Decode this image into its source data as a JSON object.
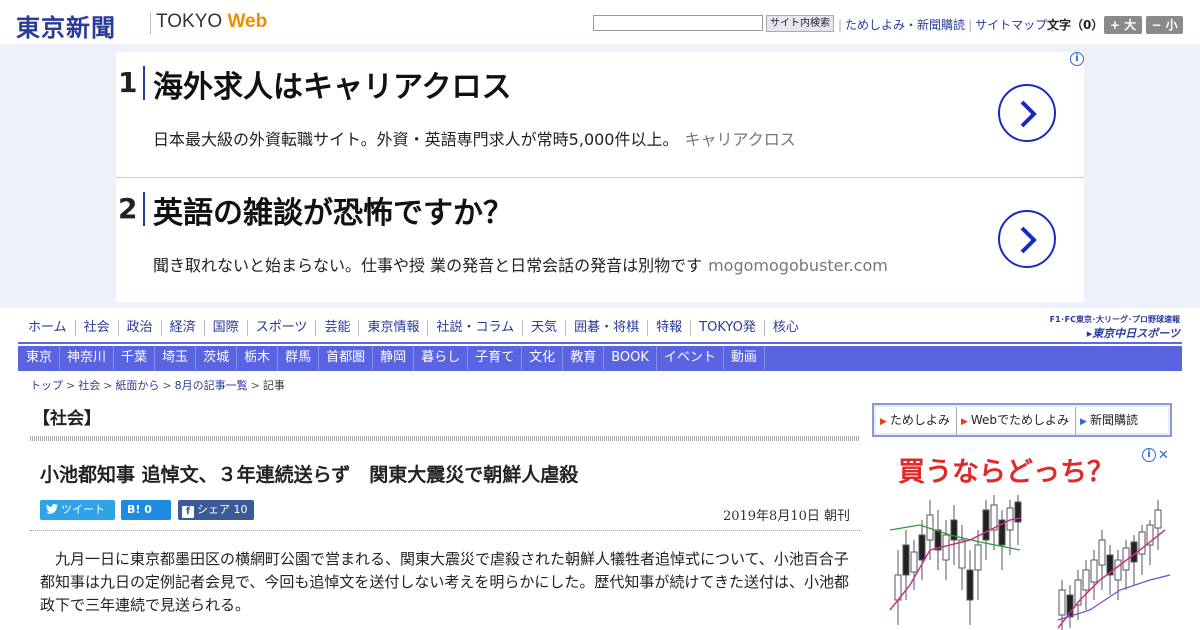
{
  "header": {
    "logo_jp": "東京新聞",
    "logo_en_prefix": "TOKYO ",
    "logo_en_web": "Web",
    "search_button": "サイト内検索",
    "links": [
      "ためしよみ・新聞購読",
      "サイトマップ"
    ],
    "fontsize_label": "文字（0）",
    "fontsize_plus": "+ 大",
    "fontsize_minus": "− 小"
  },
  "ads": {
    "info_icon": "info-icon",
    "items": [
      {
        "num": "1",
        "title": "海外求人はキャリアクロス",
        "desc": "日本最大級の外資転職サイト。外資・英語専門求人が常時5,000件以上。",
        "source": "キャリアクロス"
      },
      {
        "num": "2",
        "title": "英語の雑談が恐怖ですか？",
        "desc": "聞き取れないと始まらない。仕事や授 業の発音と日常会話の発音は別物です",
        "source": "mogomogobuster.com"
      }
    ]
  },
  "nav1": [
    "ホーム",
    "社会",
    "政治",
    "経済",
    "国際",
    "スポーツ",
    "芸能",
    "東京情報",
    "社説・コラム",
    "天気",
    "囲碁・将棋",
    "特報",
    "TOKYO発",
    "核心"
  ],
  "chunichi": {
    "top": "F1･FC東京･大リーグ･プロ野球速報",
    "logo": "▸東京中日スポーツ"
  },
  "nav2": [
    "東京",
    "神奈川",
    "千葉",
    "埼玉",
    "茨城",
    "栃木",
    "群馬",
    "首都圏",
    "静岡",
    "暮らし",
    "子育て",
    "文化",
    "教育",
    "BOOK",
    "イベント",
    "動画"
  ],
  "breadcrumb": [
    "トップ",
    "社会",
    "紙面から",
    "8月の記事一覧",
    "記事"
  ],
  "article": {
    "section": "【社会】",
    "headline": "小池都知事 追悼文、３年連続送らず　関東大震災で朝鮮人虐殺",
    "tweet": "ツイート",
    "hatena": "B! 0",
    "facebook": "シェア 10",
    "date": "2019年8月10日 朝刊",
    "body": "九月一日に東京都墨田区の横網町公園で営まれる、関東大震災で虐殺された朝鮮人犠牲者追悼式について、小池百合子都知事は九日の定例記者会見で、今回も追悼文を送付しない考えを明らかにした。歴代知事が続けてきた送付は、小池都政下で三年連続で見送られる。"
  },
  "sidebar": {
    "links": [
      "ためしよみ",
      "Webでためしよみ",
      "新聞購読"
    ],
    "ad_title": "買うならどっち？",
    "ad_close": "✕"
  }
}
